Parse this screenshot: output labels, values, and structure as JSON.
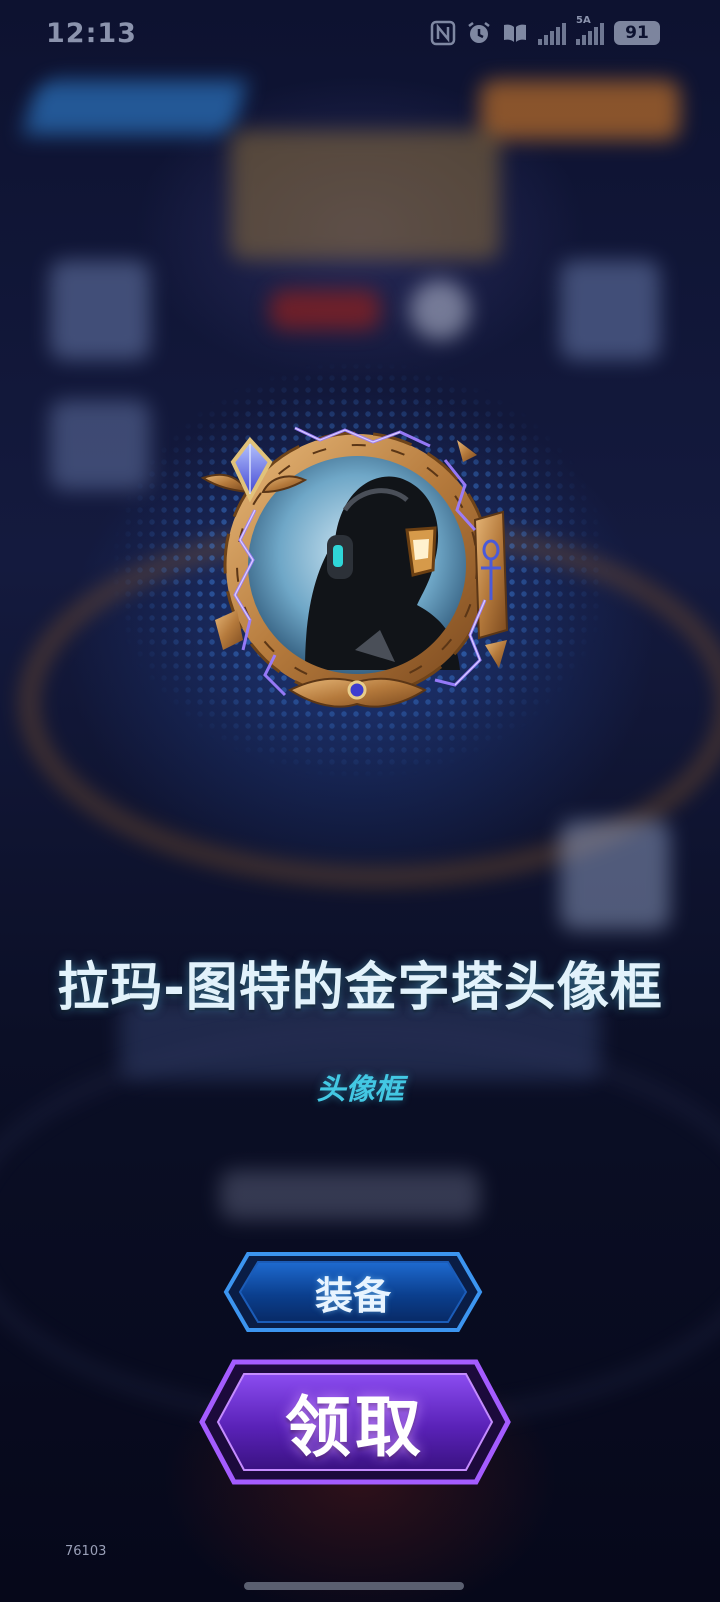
{
  "status_bar": {
    "time": "12:13",
    "icons": [
      "nfc-icon",
      "alarm-icon",
      "book-icon",
      "wifi-off-signal-icon",
      "cellular-5g-signal-icon"
    ],
    "network_label": "5A",
    "battery": "91"
  },
  "reward": {
    "item_name": "拉玛-图特的金字塔头像框",
    "item_type": "头像框",
    "frame_icon": "pyramid-avatar-frame"
  },
  "actions": {
    "equip_label": "装备",
    "claim_label": "领取"
  },
  "footer": {
    "build_id": "76103"
  },
  "colors": {
    "title": "#e2f2fb",
    "subtitle": "#43c8e3",
    "equip_button": "#0f4a9e",
    "claim_button": "#5a22b8",
    "frame_gold": "#c9934f",
    "lightning": "#8a6cff"
  }
}
